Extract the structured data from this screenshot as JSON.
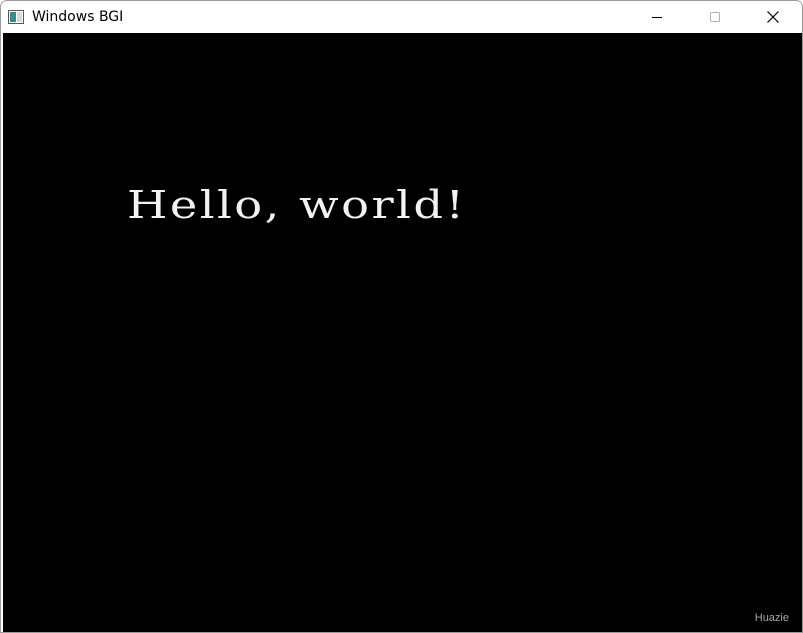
{
  "window": {
    "title": "Windows BGI",
    "app_icon": "window-app-icon",
    "controls": {
      "minimize": "minimize-icon",
      "maximize": "maximize-icon",
      "close": "close-icon"
    }
  },
  "canvas": {
    "background_color": "#000000",
    "text": "Hello, world!",
    "text_color": "#f2f2f2"
  },
  "watermark": "Huazie"
}
